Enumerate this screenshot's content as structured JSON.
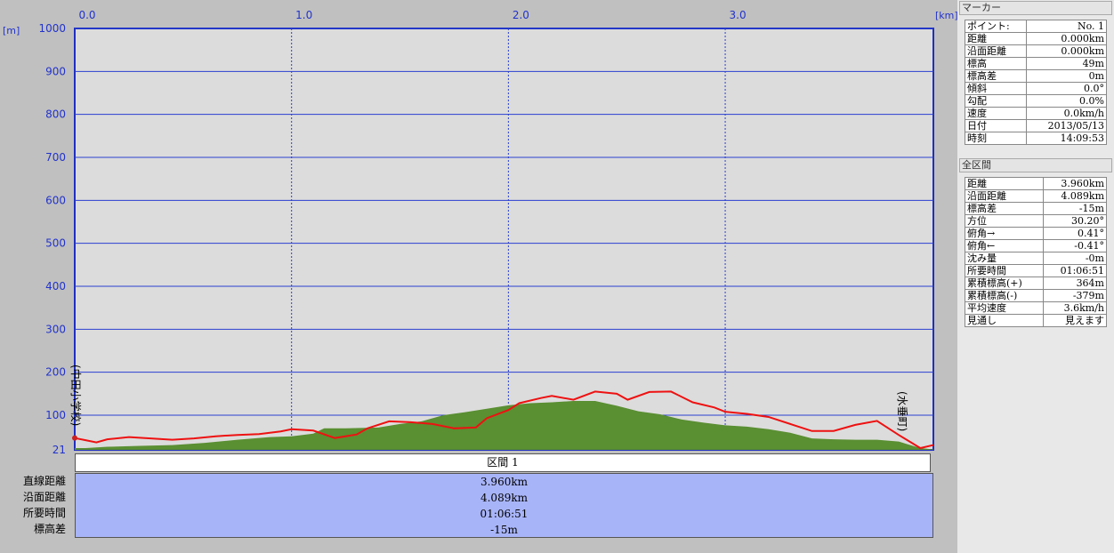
{
  "chart_data": {
    "type": "area",
    "x_unit": "[km]",
    "y_unit": "[m]",
    "x_ticks": [
      "0.0",
      "1.0",
      "2.0",
      "3.0"
    ],
    "x_tick_values": [
      0,
      1,
      2,
      3
    ],
    "x_range": [
      0,
      3.96
    ],
    "y_ticks": [
      "1000",
      "900",
      "800",
      "700",
      "600",
      "500",
      "400",
      "300",
      "200",
      "100",
      "21"
    ],
    "y_tick_values": [
      1000,
      900,
      800,
      700,
      600,
      500,
      400,
      300,
      200,
      100,
      21
    ],
    "y_range": [
      21,
      1000
    ],
    "grid": true,
    "start_label": "(中田小学校)",
    "end_label": "(水垂町)",
    "series": [
      {
        "color": "#ee1111",
        "x": [
          0,
          0.05,
          0.1,
          0.15,
          0.25,
          0.35,
          0.45,
          0.55,
          0.65,
          0.75,
          0.85,
          0.95,
          1.0,
          1.1,
          1.2,
          1.3,
          1.35,
          1.45,
          1.55,
          1.65,
          1.75,
          1.85,
          1.9,
          2.0,
          2.05,
          2.15,
          2.2,
          2.3,
          2.4,
          2.5,
          2.55,
          2.65,
          2.75,
          2.85,
          2.95,
          3.0,
          3.1,
          3.2,
          3.3,
          3.4,
          3.5,
          3.6,
          3.7,
          3.8,
          3.9,
          3.96
        ],
        "y": [
          48,
          43,
          38,
          45,
          50,
          47,
          44,
          47,
          52,
          55,
          57,
          63,
          68,
          65,
          48,
          56,
          70,
          86,
          84,
          80,
          70,
          72,
          93,
          112,
          128,
          140,
          145,
          136,
          155,
          150,
          136,
          154,
          155,
          130,
          118,
          108,
          103,
          96,
          80,
          64,
          64,
          78,
          87,
          55,
          25,
          32
        ]
      },
      {
        "color": "#5a8f32",
        "x": [
          0,
          0.05,
          0.15,
          0.3,
          0.45,
          0.6,
          0.75,
          0.9,
          1.0,
          1.1,
          1.15,
          1.25,
          1.4,
          1.5,
          1.6,
          1.7,
          1.8,
          1.9,
          2.0,
          2.1,
          2.2,
          2.3,
          2.4,
          2.5,
          2.6,
          2.7,
          2.8,
          2.9,
          3.0,
          3.1,
          3.2,
          3.3,
          3.4,
          3.5,
          3.6,
          3.7,
          3.8,
          3.9,
          3.96
        ],
        "y": [
          25,
          25,
          28,
          30,
          32,
          37,
          44,
          50,
          52,
          58,
          70,
          70,
          72,
          80,
          86,
          100,
          107,
          115,
          123,
          128,
          130,
          133,
          133,
          122,
          109,
          102,
          90,
          83,
          77,
          74,
          68,
          60,
          47,
          45,
          44,
          44,
          40,
          25,
          22
        ]
      }
    ]
  },
  "section": {
    "header": "区間 1",
    "labels": [
      "直線距離",
      "沿面距離",
      "所要時間",
      "標高差"
    ],
    "values": [
      "3.960km",
      "4.089km",
      "01:06:51",
      "-15m"
    ]
  },
  "panel": {
    "marker_title": "マーカー",
    "marker_rows": [
      {
        "k": "ポイント:",
        "v": "No. 1"
      },
      {
        "k": "距離",
        "v": "0.000km"
      },
      {
        "k": "沿面距離",
        "v": "0.000km"
      },
      {
        "k": "標高",
        "v": "49m"
      },
      {
        "k": "標高差",
        "v": "0m"
      },
      {
        "k": "傾斜",
        "v": "0.0°"
      },
      {
        "k": "勾配",
        "v": "0.0%"
      },
      {
        "k": "速度",
        "v": "0.0km/h"
      },
      {
        "k": "日付",
        "v": "2013/05/13"
      },
      {
        "k": "時刻",
        "v": "14:09:53"
      }
    ],
    "total_title": "全区間",
    "total_rows": [
      {
        "k": "距離",
        "v": "3.960km"
      },
      {
        "k": "沿面距離",
        "v": "4.089km"
      },
      {
        "k": "標高差",
        "v": "-15m"
      },
      {
        "k": "方位",
        "v": "30.20°"
      },
      {
        "k": "俯角→",
        "v": "0.41°"
      },
      {
        "k": "俯角←",
        "v": "-0.41°"
      },
      {
        "k": "沈み量",
        "v": "-0m"
      },
      {
        "k": "所要時間",
        "v": "01:06:51"
      },
      {
        "k": "累積標高(+)",
        "v": "364m"
      },
      {
        "k": "累積標高(-)",
        "v": "-379m"
      },
      {
        "k": "平均速度",
        "v": "3.6km/h"
      },
      {
        "k": "見通し",
        "v": "見えます"
      }
    ]
  }
}
